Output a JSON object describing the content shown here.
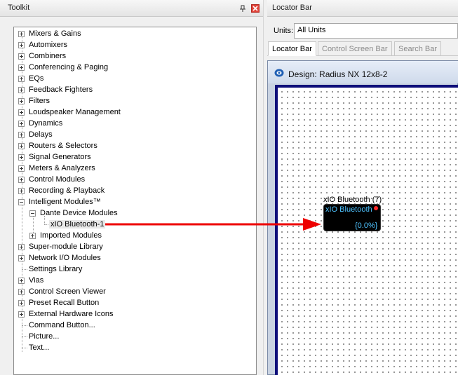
{
  "toolkit": {
    "title": "Toolkit",
    "items": [
      {
        "label": "Mixers & Gains",
        "expander": "plus"
      },
      {
        "label": "Automixers",
        "expander": "plus"
      },
      {
        "label": "Combiners",
        "expander": "plus"
      },
      {
        "label": "Conferencing & Paging",
        "expander": "plus"
      },
      {
        "label": "EQs",
        "expander": "plus"
      },
      {
        "label": "Feedback Fighters",
        "expander": "plus"
      },
      {
        "label": "Filters",
        "expander": "plus"
      },
      {
        "label": "Loudspeaker Management",
        "expander": "plus"
      },
      {
        "label": "Dynamics",
        "expander": "plus"
      },
      {
        "label": "Delays",
        "expander": "plus"
      },
      {
        "label": "Routers & Selectors",
        "expander": "plus"
      },
      {
        "label": "Signal Generators",
        "expander": "plus"
      },
      {
        "label": "Meters & Analyzers",
        "expander": "plus"
      },
      {
        "label": "Control Modules",
        "expander": "plus"
      },
      {
        "label": "Recording & Playback",
        "expander": "plus"
      },
      {
        "label": "Intelligent Modules™",
        "expander": "minus"
      },
      {
        "label": "Dante Device Modules",
        "expander": "minus",
        "level": 1
      },
      {
        "label": "xIO Bluetooth-1",
        "expander": "none",
        "level": 2,
        "selected": true
      },
      {
        "label": "Imported Modules",
        "expander": "plus",
        "level": 1
      },
      {
        "label": "Super-module Library",
        "expander": "plus"
      },
      {
        "label": "Network I/O Modules",
        "expander": "plus"
      },
      {
        "label": "Settings Library",
        "expander": "none"
      },
      {
        "label": "Vias",
        "expander": "plus"
      },
      {
        "label": "Control Screen Viewer",
        "expander": "plus"
      },
      {
        "label": "Preset Recall Button",
        "expander": "plus"
      },
      {
        "label": "External Hardware Icons",
        "expander": "plus"
      },
      {
        "label": "Command Button...",
        "expander": "none"
      },
      {
        "label": "Picture...",
        "expander": "none"
      },
      {
        "label": "Text...",
        "expander": "none"
      }
    ]
  },
  "locator": {
    "title": "Locator Bar",
    "units_label": "Units:",
    "units_value": "All Units",
    "tabs": [
      {
        "label": "Locator Bar",
        "active": true
      },
      {
        "label": "Control Screen Bar",
        "active": false
      },
      {
        "label": "Search Bar",
        "active": false
      }
    ]
  },
  "design": {
    "title": "Design: Radius NX 12x8-2",
    "block": {
      "label": "xIO Bluetooth (7)",
      "name": "xIO Bluetooth",
      "value": "{0.0%}"
    }
  },
  "colors": {
    "arrow": "#ee0000",
    "canvas_border": "#0e0e7a",
    "block_text": "#4fc3ff",
    "close_button": "#e2443a"
  }
}
